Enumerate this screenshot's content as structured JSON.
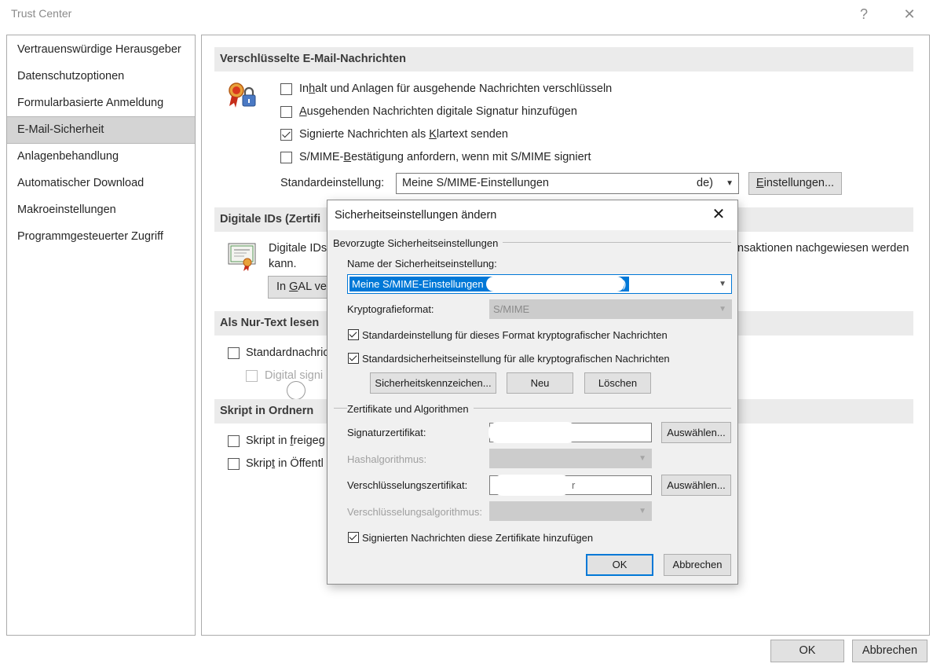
{
  "window": {
    "title": "Trust Center",
    "help_glyph": "?",
    "close_glyph": "✕"
  },
  "nav": {
    "items": [
      {
        "label": "Vertrauenswürdige Herausgeber"
      },
      {
        "label": "Datenschutzoptionen"
      },
      {
        "label": "Formularbasierte Anmeldung"
      },
      {
        "label": "E-Mail-Sicherheit",
        "selected": true
      },
      {
        "label": "Anlagenbehandlung"
      },
      {
        "label": "Automatischer Download"
      },
      {
        "label": "Makroeinstellungen"
      },
      {
        "label": "Programmgesteuerter Zugriff"
      }
    ]
  },
  "encrypted": {
    "header": "Verschlüsselte E-Mail-Nachrichten",
    "opt1_pre": "In",
    "opt1_u": "h",
    "opt1_post": "alt und Anlagen für ausgehende Nachrichten verschlüsseln",
    "opt2_pre": "",
    "opt2_u": "A",
    "opt2_post": "usgehenden Nachrichten digitale Signatur hinzufügen",
    "opt3_pre": "Signierte Nachrichten als ",
    "opt3_u": "K",
    "opt3_post": "lartext senden",
    "opt4_pre": "S/MIME-",
    "opt4_u": "B",
    "opt4_post": "estätigung anfordern, wenn mit S/MIME signiert",
    "default_label": "Standardeinstellung:",
    "default_value": "Meine S/MIME-Einstellungen",
    "default_value_tail": "de)",
    "settings_btn_u": "E",
    "settings_btn_post": "instellungen..."
  },
  "digital_ids": {
    "header": "Digitale IDs (Zertifi",
    "text_line1": "Digitale IDs",
    "text_line1_tail": "nsaktionen nachgewiesen werden",
    "text_line2": "kann.",
    "btn_pre": "In ",
    "btn_u": "G",
    "btn_post": "AL ver"
  },
  "plain_text": {
    "header": "Als Nur-Text lesen",
    "opt1": "Standardnachric",
    "opt2": "Digital signi"
  },
  "script": {
    "header": "Skript in Ordnern",
    "opt1_pre": "Skript in ",
    "opt1_u": "f",
    "opt1_post": "reigeg",
    "opt2_pre": "Skrip",
    "opt2_u": "t",
    "opt2_post": " in Öffentl"
  },
  "footer": {
    "ok": "OK",
    "cancel": "Abbrechen"
  },
  "dialog": {
    "title": "Sicherheitseinstellungen ändern",
    "close_glyph": "✕",
    "group1": "Bevorzugte Sicherheitseinstellungen",
    "name_label": "Name der Sicherheitseinstellung:",
    "name_value": "Meine S/MIME-Einstellungen (",
    "name_value_tail": ")",
    "crypto_label": "Kryptografieformat:",
    "crypto_value": "S/MIME",
    "cb1": "Standardeinstellung für dieses Format kryptografischer Nachrichten",
    "cb2": "Standardsicherheitseinstellung für alle kryptografischen Nachrichten",
    "btn_labels": "Sicherheitskennzeichen...",
    "btn_new": "Neu",
    "btn_delete": "Löschen",
    "group2": "Zertifikate und Algorithmen",
    "sig_label": "Signaturzertifikat:",
    "hash_label": "Hashalgorithmus:",
    "enc_label": "Verschlüsselungszertifikat:",
    "enc_value_tail": "r",
    "encalg_label": "Verschlüsselungsalgorithmus:",
    "choose1": "Auswählen...",
    "choose2": "Auswählen...",
    "cb3": "Signierten Nachrichten diese Zertifikate hinzufügen",
    "ok": "OK",
    "cancel": "Abbrechen"
  }
}
